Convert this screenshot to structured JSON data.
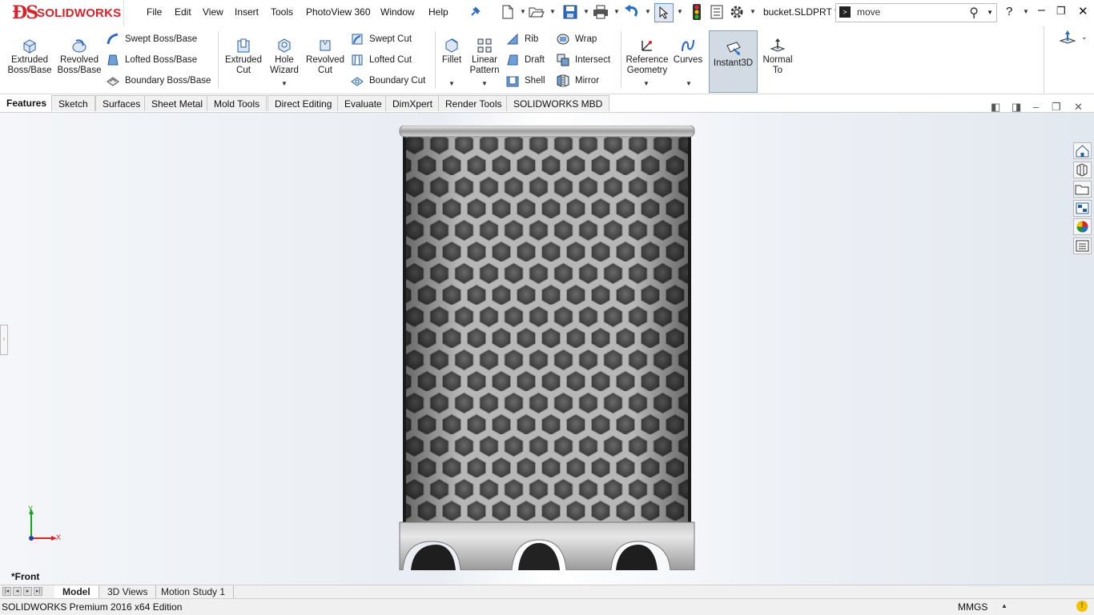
{
  "app": {
    "brand": "SOLIDWORKS",
    "brand_color": "#d8232a"
  },
  "menu": [
    "File",
    "Edit",
    "View",
    "Insert",
    "Tools",
    "PhotoView 360",
    "Window",
    "Help"
  ],
  "document_title": "bucket.SLDPRT *",
  "search": {
    "value": "move"
  },
  "command_manager": {
    "features": {
      "extruded_boss": "Extruded\nBoss/Base",
      "revolved_boss": "Revolved\nBoss/Base",
      "swept_boss": "Swept Boss/Base",
      "lofted_boss": "Lofted Boss/Base",
      "boundary_boss": "Boundary Boss/Base",
      "extruded_cut": "Extruded\nCut",
      "hole_wizard": "Hole\nWizard",
      "revolved_cut": "Revolved\nCut",
      "swept_cut": "Swept Cut",
      "lofted_cut": "Lofted Cut",
      "boundary_cut": "Boundary Cut",
      "fillet": "Fillet",
      "linear_pattern": "Linear\nPattern",
      "rib": "Rib",
      "draft": "Draft",
      "shell": "Shell",
      "wrap": "Wrap",
      "intersect": "Intersect",
      "mirror": "Mirror",
      "reference_geometry": "Reference\nGeometry",
      "curves": "Curves",
      "instant3d": "Instant3D",
      "normal_to": "Normal\nTo"
    }
  },
  "tabs": [
    "Features",
    "Sketch",
    "Surfaces",
    "Sheet Metal",
    "Mold Tools",
    "Direct Editing",
    "Evaluate",
    "DimXpert",
    "Render Tools",
    "SOLIDWORKS MBD"
  ],
  "active_tab": "Features",
  "viewport": {
    "view_name": "*Front",
    "axis_x": "X",
    "axis_y": "Y"
  },
  "bottom_tabs": [
    "Model",
    "3D Views",
    "Motion Study 1"
  ],
  "status": {
    "edition": "SOLIDWORKS Premium 2016 x64 Edition",
    "units": "MMGS"
  }
}
